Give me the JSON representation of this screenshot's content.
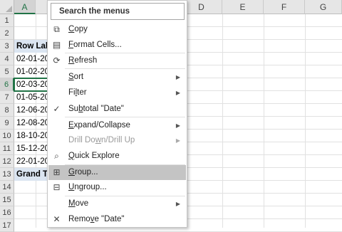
{
  "sheet": {
    "columns": [
      "A",
      "B",
      "C",
      "D",
      "E",
      "F",
      "G"
    ],
    "rows": [
      "1",
      "2",
      "3",
      "4",
      "5",
      "6",
      "7",
      "8",
      "9",
      "10",
      "11",
      "12",
      "13",
      "14",
      "15",
      "16",
      "17"
    ],
    "selected_column": "A",
    "selected_row": "6",
    "cells": [
      {
        "row": "3",
        "text": "Row Lab",
        "bold": true,
        "band": true
      },
      {
        "row": "4",
        "text": "02-01-20"
      },
      {
        "row": "5",
        "text": "01-02-20"
      },
      {
        "row": "6",
        "text": "02-03-20"
      },
      {
        "row": "7",
        "text": "01-05-20"
      },
      {
        "row": "8",
        "text": "12-06-20"
      },
      {
        "row": "9",
        "text": "12-08-20"
      },
      {
        "row": "10",
        "text": "18-10-20"
      },
      {
        "row": "11",
        "text": "15-12-20"
      },
      {
        "row": "12",
        "text": "22-01-20"
      },
      {
        "row": "13",
        "text": "Grand T",
        "bold": true,
        "band": true
      }
    ]
  },
  "menu": {
    "search_label": "Search the menus",
    "items": [
      {
        "pre": "",
        "acc": "C",
        "post": "opy",
        "icon": "copy-icon",
        "glyph": "⧉"
      },
      {
        "pre": "",
        "acc": "F",
        "post": "ormat Cells...",
        "icon": "format-cells-icon",
        "glyph": "▤"
      },
      {
        "pre": "",
        "acc": "R",
        "post": "efresh",
        "icon": "refresh-icon",
        "glyph": "⟳"
      },
      {
        "pre": "",
        "acc": "S",
        "post": "ort",
        "icon": "",
        "glyph": ""
      },
      {
        "pre": "Fi",
        "acc": "l",
        "post": "ter",
        "icon": "",
        "glyph": ""
      },
      {
        "pre": "Su",
        "acc": "b",
        "post": "total \"Date\"",
        "icon": "checkmark-icon",
        "glyph": "✓"
      },
      {
        "pre": "",
        "acc": "E",
        "post": "xpand/Collapse",
        "icon": "",
        "glyph": ""
      },
      {
        "pre": "Drill Do",
        "acc": "w",
        "post": "n/Drill Up",
        "icon": "",
        "glyph": ""
      },
      {
        "pre": "",
        "acc": "Q",
        "post": "uick Explore",
        "icon": "quick-explore-icon",
        "glyph": "⌕"
      },
      {
        "pre": "",
        "acc": "G",
        "post": "roup...",
        "icon": "group-icon",
        "glyph": "⊞"
      },
      {
        "pre": "",
        "acc": "U",
        "post": "ngroup...",
        "icon": "ungroup-icon",
        "glyph": "⊟"
      },
      {
        "pre": "",
        "acc": "M",
        "post": "ove",
        "icon": "",
        "glyph": ""
      },
      {
        "pre": "Remo",
        "acc": "v",
        "post": "e \"Date\"",
        "icon": "remove-icon",
        "glyph": "✕"
      }
    ],
    "submenu_arrow": "▶"
  }
}
